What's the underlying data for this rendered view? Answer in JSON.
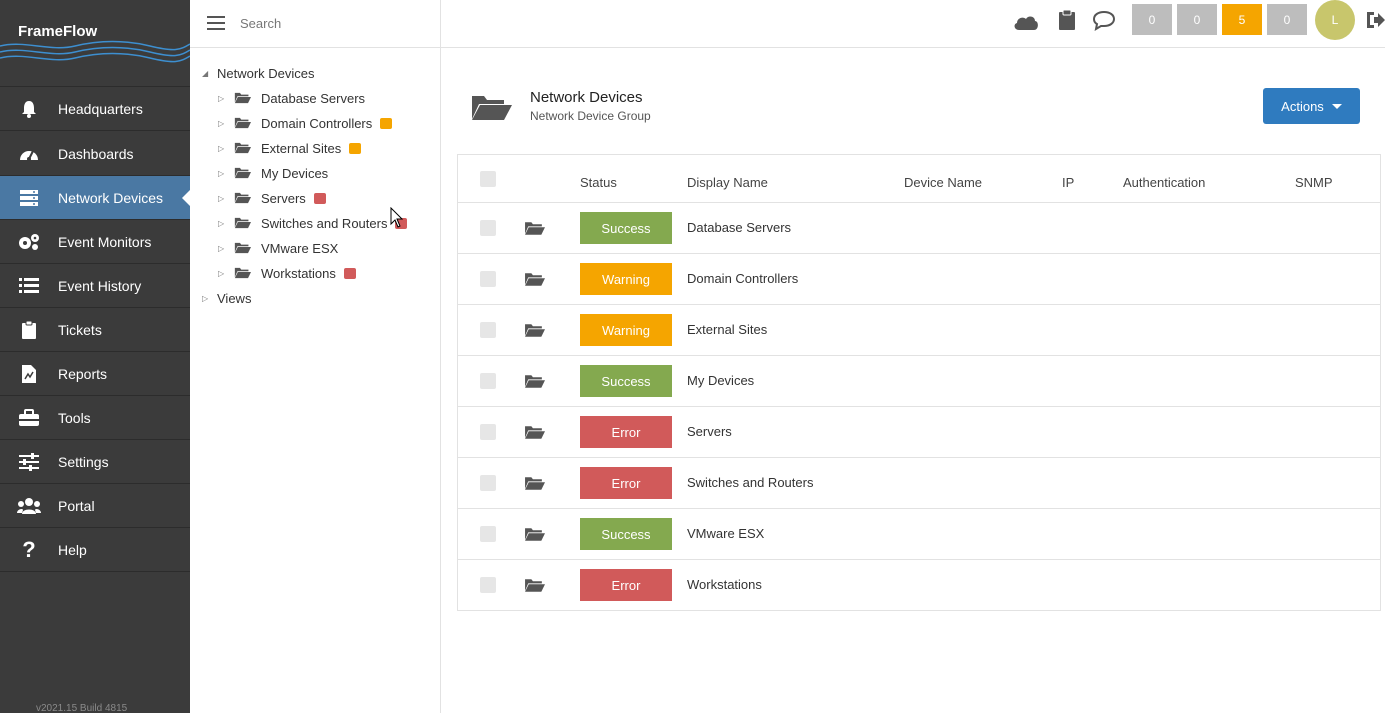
{
  "app": {
    "logo": "FrameFlow",
    "version": "v2021.15 Build 4815"
  },
  "colors": {
    "success": "#84a94f",
    "warning": "#f5a500",
    "error": "#d15a5a",
    "accent": "#2f7bbf",
    "sidebar": "#3b3b3b",
    "sidebar_active": "#4a78a3"
  },
  "sidebar": {
    "items": [
      {
        "label": "Headquarters",
        "icon": "bell-icon"
      },
      {
        "label": "Dashboards",
        "icon": "gauge-icon"
      },
      {
        "label": "Network Devices",
        "icon": "server-icon",
        "active": true
      },
      {
        "label": "Event Monitors",
        "icon": "gears-icon"
      },
      {
        "label": "Event History",
        "icon": "list-icon"
      },
      {
        "label": "Tickets",
        "icon": "clipboard-icon"
      },
      {
        "label": "Reports",
        "icon": "report-icon"
      },
      {
        "label": "Tools",
        "icon": "toolbox-icon"
      },
      {
        "label": "Settings",
        "icon": "sliders-icon"
      },
      {
        "label": "Portal",
        "icon": "users-icon"
      },
      {
        "label": "Help",
        "icon": "question-icon"
      }
    ]
  },
  "search": {
    "placeholder": "Search"
  },
  "tree": {
    "root": "Network Devices",
    "children": [
      {
        "label": "Database Servers",
        "status": ""
      },
      {
        "label": "Domain Controllers",
        "status": "warning"
      },
      {
        "label": "External Sites",
        "status": "warning"
      },
      {
        "label": "My Devices",
        "status": ""
      },
      {
        "label": "Servers",
        "status": "error"
      },
      {
        "label": "Switches and Routers",
        "status": "error"
      },
      {
        "label": "VMware ESX",
        "status": ""
      },
      {
        "label": "Workstations",
        "status": "error"
      }
    ],
    "views": "Views"
  },
  "topbar": {
    "icons": [
      "cloud-icon",
      "clipboard-icon",
      "chat-icon",
      "logout-icon"
    ],
    "counters": [
      {
        "value": "0",
        "color": "#bdbdbd"
      },
      {
        "value": "0",
        "color": "#bdbdbd"
      },
      {
        "value": "5",
        "color": "#f5a500"
      },
      {
        "value": "0",
        "color": "#bdbdbd"
      }
    ],
    "avatar": "L"
  },
  "header": {
    "title": "Network Devices",
    "subtitle": "Network Device Group",
    "actions_label": "Actions"
  },
  "table": {
    "columns": [
      "Status",
      "Display Name",
      "Device Name",
      "IP",
      "Authentication",
      "SNMP"
    ],
    "rows": [
      {
        "status": "Success",
        "name": "Database Servers"
      },
      {
        "status": "Warning",
        "name": "Domain Controllers"
      },
      {
        "status": "Warning",
        "name": "External Sites"
      },
      {
        "status": "Success",
        "name": "My Devices"
      },
      {
        "status": "Error",
        "name": "Servers"
      },
      {
        "status": "Error",
        "name": "Switches and Routers"
      },
      {
        "status": "Success",
        "name": "VMware ESX"
      },
      {
        "status": "Error",
        "name": "Workstations"
      }
    ]
  }
}
